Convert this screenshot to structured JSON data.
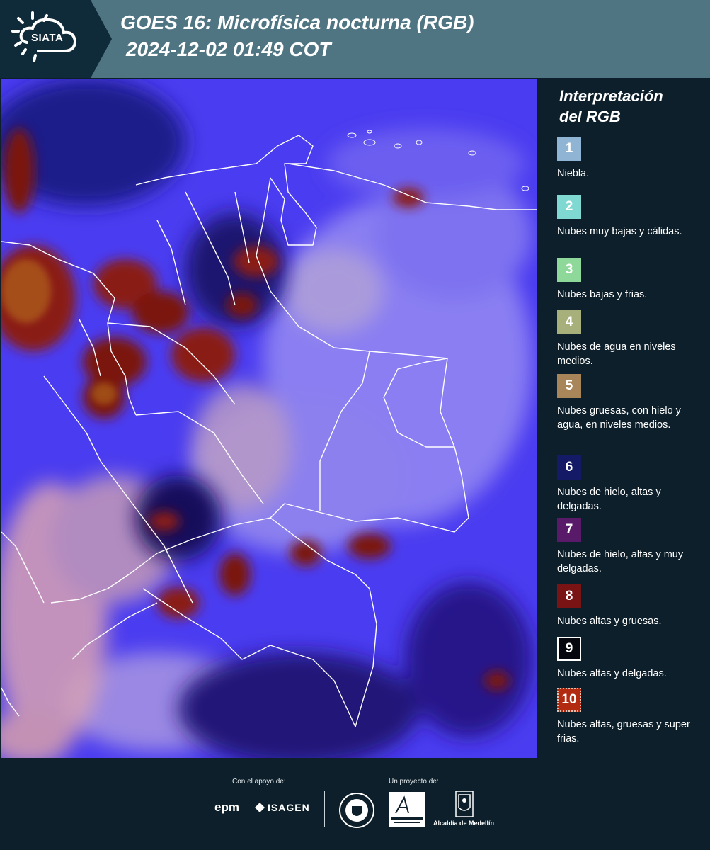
{
  "header": {
    "logo_text": "SIATA",
    "title_line1": "GOES 16: Microfísica nocturna (RGB)",
    "title_line2": "2024-12-02 01:49 COT"
  },
  "legend": {
    "title_line1": "Interpretación",
    "title_line2": "del RGB",
    "items": [
      {
        "number": "1",
        "label": "Niebla.",
        "color": "#8fb4d4"
      },
      {
        "number": "2",
        "label": "Nubes muy bajas y cálidas.",
        "color": "#7fd8d2"
      },
      {
        "number": "3",
        "label": "Nubes bajas y frias.",
        "color": "#8ed99a"
      },
      {
        "number": "4",
        "label": "Nubes de agua en niveles medios.",
        "color": "#a7b07a"
      },
      {
        "number": "5",
        "label": "Nubes gruesas, con hielo y agua, en niveles medios.",
        "color": "#a8865a"
      },
      {
        "number": "6",
        "label": "Nubes de hielo, altas y delgadas.",
        "color": "#141a66"
      },
      {
        "number": "7",
        "label": "Nubes de hielo, altas y muy delgadas.",
        "color": "#5a1a6a"
      },
      {
        "number": "8",
        "label": "Nubes altas y gruesas.",
        "color": "#7a1414"
      },
      {
        "number": "9",
        "label": "Nubes altas y delgadas.",
        "color": "#06060e"
      },
      {
        "number": "10",
        "label": "Nubes altas, gruesas y super frias.",
        "color": "#b22a10"
      }
    ]
  },
  "footer": {
    "support_label": "Con el apoyo de:",
    "project_label": "Un proyecto de:",
    "epm": "epm",
    "isagen": "ISAGEN",
    "alcaldia": "Alcaldía de Medellín"
  }
}
